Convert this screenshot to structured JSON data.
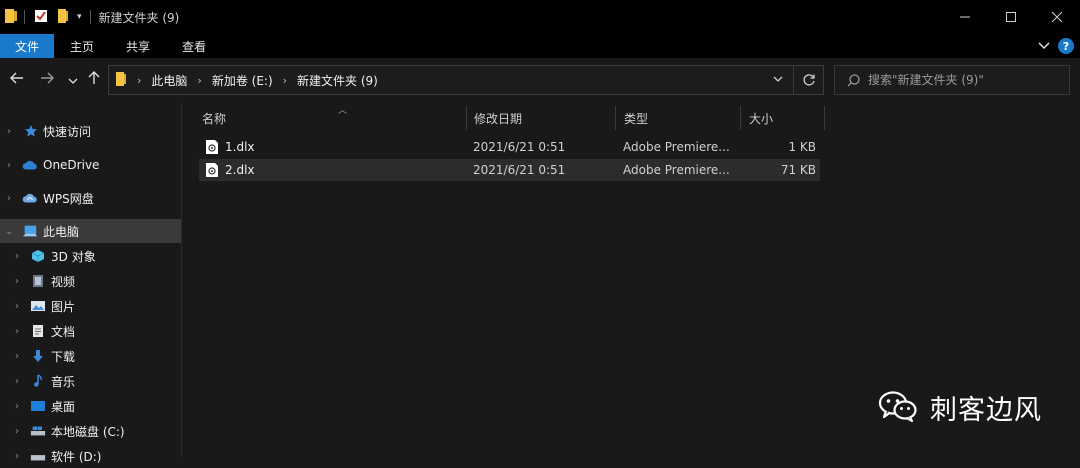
{
  "window": {
    "title": "新建文件夹 (9)"
  },
  "ribbon": {
    "tabs": [
      {
        "label": "文件",
        "active": true
      },
      {
        "label": "主页"
      },
      {
        "label": "共享"
      },
      {
        "label": "查看"
      }
    ],
    "help": "?"
  },
  "address": {
    "crumbs": [
      "此电脑",
      "新加卷 (E:)",
      "新建文件夹 (9)"
    ]
  },
  "search": {
    "placeholder": "搜索\"新建文件夹 (9)\""
  },
  "nav": {
    "quick_access": "快速访问",
    "onedrive": "OneDrive",
    "wps": "WPS网盘",
    "this_pc": "此电脑",
    "children": [
      "3D 对象",
      "视频",
      "图片",
      "文档",
      "下载",
      "音乐",
      "桌面",
      "本地磁盘 (C:)",
      "软件 (D:)"
    ]
  },
  "columns": {
    "name": "名称",
    "date": "修改日期",
    "type": "类型",
    "size": "大小"
  },
  "files": [
    {
      "name": "1.dlx",
      "date": "2021/6/21 0:51",
      "type": "Adobe Premiere...",
      "size": "1 KB"
    },
    {
      "name": "2.dlx",
      "date": "2021/6/21 0:51",
      "type": "Adobe Premiere...",
      "size": "71 KB",
      "selected": true
    }
  ],
  "watermark": {
    "text": "刺客边风"
  },
  "colors": {
    "accent": "#1979ca",
    "background": "#191919",
    "titlebar": "#000000",
    "selected_row": "#2c2c2c",
    "folder": "#f5c342"
  }
}
